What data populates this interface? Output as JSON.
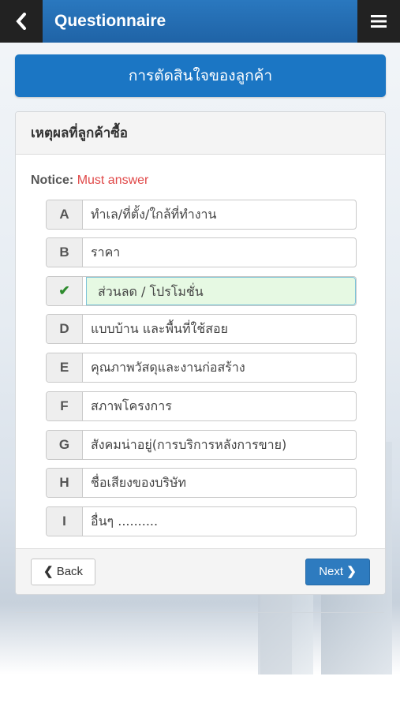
{
  "header": {
    "title": "Questionnaire",
    "back_icon": "chevron-left-icon",
    "menu_icon": "hamburger-menu-icon"
  },
  "section_title": "การตัดสินใจของลูกค้า",
  "question": {
    "title": "เหตุผลที่ลูกค้าซื้อ",
    "notice_label": "Notice:",
    "notice_text": "Must answer",
    "options": [
      {
        "key": "A",
        "label": "ทำเล/ที่ตั้ง/ใกล้ที่ทำงาน",
        "selected": false
      },
      {
        "key": "B",
        "label": "ราคา",
        "selected": false
      },
      {
        "key": "✔",
        "label": "ส่วนลด / โปรโมชั่น",
        "selected": true
      },
      {
        "key": "D",
        "label": "แบบบ้าน และพื้นที่ใช้สอย",
        "selected": false
      },
      {
        "key": "E",
        "label": "คุณภาพวัสดุและงานก่อสร้าง",
        "selected": false
      },
      {
        "key": "F",
        "label": "สภาพโครงการ",
        "selected": false
      },
      {
        "key": "G",
        "label": "สังคมน่าอยู่(การบริการหลังการขาย)",
        "selected": false
      },
      {
        "key": "H",
        "label": "ชื่อเสียงของบริษัท",
        "selected": false
      },
      {
        "key": "I",
        "label": "อื่นๆ ..........",
        "selected": false
      }
    ]
  },
  "footer": {
    "back_label": "Back",
    "next_label": "Next"
  },
  "colors": {
    "primary": "#1b76c4",
    "notice_red": "#e04848",
    "selected_bg": "#e6f9e3",
    "check_green": "#2e8b2e"
  }
}
